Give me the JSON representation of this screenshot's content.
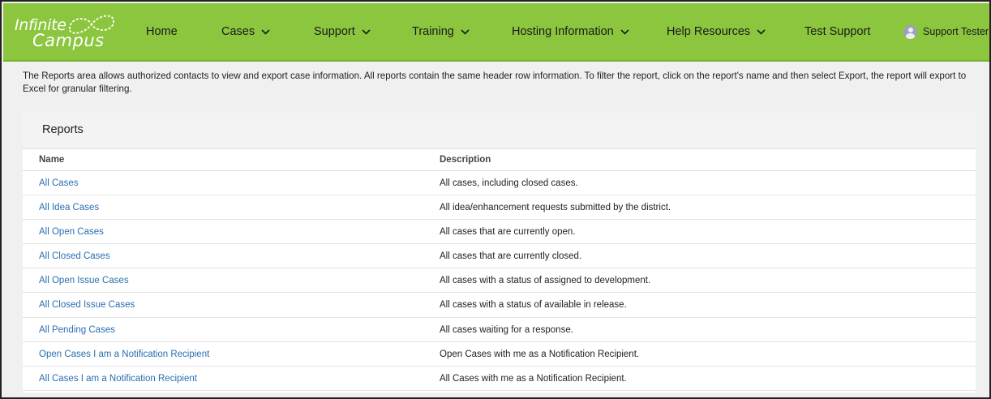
{
  "header": {
    "logo_line1": "Infinite",
    "logo_line2": "Campus",
    "nav": [
      {
        "label": "Home",
        "has_dropdown": false
      },
      {
        "label": "Cases",
        "has_dropdown": true
      },
      {
        "label": "Support",
        "has_dropdown": true
      },
      {
        "label": "Training",
        "has_dropdown": true
      },
      {
        "label": "Hosting Information",
        "has_dropdown": true
      },
      {
        "label": "Help Resources",
        "has_dropdown": true
      },
      {
        "label": "Test Support",
        "has_dropdown": false
      }
    ],
    "user_name": "Support Tester",
    "accent_color": "#8cc63f"
  },
  "intro_text": "The Reports area allows authorized contacts to view and export case information. All reports contain the same header row information. To filter the report, click on the report's name and then select Export, the report will export to Excel for granular filtering.",
  "reports": {
    "title": "Reports",
    "columns": {
      "name": "Name",
      "description": "Description"
    },
    "rows": [
      {
        "name": "All Cases",
        "description": "All cases, including closed cases."
      },
      {
        "name": "All Idea Cases",
        "description": "All idea/enhancement requests submitted by the district."
      },
      {
        "name": "All Open Cases",
        "description": "All cases that are currently open."
      },
      {
        "name": "All Closed Cases",
        "description": "All cases that are currently closed."
      },
      {
        "name": "All Open Issue Cases",
        "description": "All cases with a status of assigned to development."
      },
      {
        "name": "All Closed Issue Cases",
        "description": "All cases with a status of available in release."
      },
      {
        "name": "All Pending Cases",
        "description": "All cases waiting for a response."
      },
      {
        "name": "Open Cases I am a Notification Recipient",
        "description": "Open Cases with me as a Notification Recipient."
      },
      {
        "name": "All Cases I am a Notification Recipient",
        "description": "All Cases with me as a Notification Recipient."
      }
    ]
  }
}
